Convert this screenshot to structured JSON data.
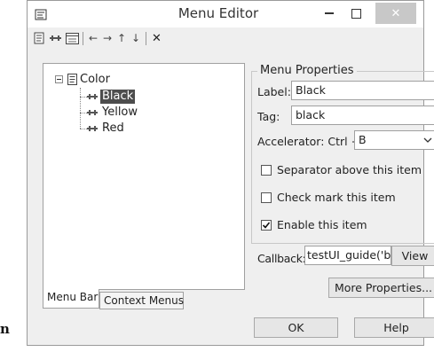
{
  "window": {
    "title": "Menu Editor",
    "close_glyph": "✕"
  },
  "toolbar": {
    "icons": [
      "new-menu-icon",
      "new-item-icon",
      "new-context-menu-icon",
      "outdent-icon",
      "indent-icon",
      "move-up-icon",
      "move-down-icon",
      "delete-icon"
    ],
    "glyphs": {
      "outdent": "←",
      "indent": "→",
      "up": "↑",
      "down": "↓",
      "delete": "✕"
    }
  },
  "tree": {
    "root": "Color",
    "children": [
      "Black",
      "Yellow",
      "Red"
    ],
    "selected": "Black"
  },
  "tabs": [
    "Menu Bar",
    "Context Menus"
  ],
  "properties": {
    "group_title": "Menu Properties",
    "label_caption": "Label:",
    "label_value": "Black",
    "tag_caption": "Tag:",
    "tag_value": "black",
    "accelerator_caption": "Accelerator: Ctrl +",
    "accelerator_value": "B",
    "separator_label": "Separator above this item",
    "separator_checked": false,
    "checkmark_label": "Check mark this item",
    "checkmark_checked": false,
    "enable_label": "Enable this item",
    "enable_checked": true,
    "callback_caption": "Callback:",
    "callback_value": "testUI_guide('bl",
    "view_label": "View",
    "more_label": "More Properties..."
  },
  "footer": {
    "ok_label": "OK",
    "help_label": "Help"
  },
  "page_fragment": "n",
  "colors": {
    "selection": "#4d4d4d",
    "window_bg": "#efefef",
    "close_button": "#c8c8c8"
  }
}
